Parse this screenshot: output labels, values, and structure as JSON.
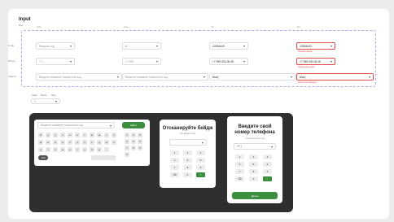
{
  "header": {
    "title": "Input",
    "subtitle": "Все"
  },
  "columns": [
    "Size",
    "Icon",
    "Tel",
    "Err"
  ],
  "rows": [
    {
      "label": "Code"
    },
    {
      "label": "Phone"
    },
    {
      "label": "Search"
    }
  ],
  "code_row": {
    "placeholder": "Введите код",
    "value": "1",
    "filled": "12334443",
    "error_value": "12334443",
    "error_text": "Ошибка ввода"
  },
  "phone_row": {
    "code_a": "+7 |",
    "code_b": "+7 999",
    "filled": "+7 999 000-00-00",
    "error_value": "+7 999 000-00-00",
    "error_text": "Неверный номер"
  },
  "search_row": {
    "placeholder_a": "Введите название товара или код",
    "placeholder_b": "Введите название товара или код",
    "value_a": "Мол|",
    "value_b": "Мол|",
    "error_text": "Ничего не найдено"
  },
  "mini_controls": {
    "labels": [
      "State",
      "Mode",
      "Size"
    ],
    "select_value": "S"
  },
  "keyboard_panel": {
    "search_placeholder": "Введите название товара или код",
    "action_label": "Найти",
    "letters_row1": [
      "й",
      "ц",
      "у",
      "к",
      "е",
      "н",
      "г",
      "ш",
      "щ",
      "з",
      "х"
    ],
    "letters_row2": [
      "ф",
      "ы",
      "в",
      "а",
      "п",
      "р",
      "о",
      "л",
      "д",
      "ж",
      "э"
    ],
    "letters_row3": [
      "я",
      "ч",
      "с",
      "м",
      "и",
      "т",
      "ь",
      "б",
      "ю",
      "."
    ],
    "bottom_label": "123",
    "numpad": [
      "1",
      "2",
      "3",
      "4",
      "5",
      "6",
      "7",
      "8",
      "9",
      "0"
    ]
  },
  "scan_modal": {
    "title": "Отсканируйте бейдж",
    "subtitle": "или введите код",
    "keys": [
      "1",
      "2",
      "3",
      "4",
      "5",
      "6",
      "7",
      "8",
      "9",
      "⌫",
      "0",
      "✓"
    ]
  },
  "phone_modal": {
    "title_line1": "Введите свой",
    "title_line2": "номер телефона",
    "subtitle": "Чтобы получить чек",
    "prefix": "+7 |",
    "keys": [
      "1",
      "2",
      "3",
      "4",
      "5",
      "6",
      "7",
      "8",
      "9",
      "⌫",
      "0",
      "✓"
    ],
    "submit_label": "Далее"
  },
  "colors": {
    "accent": "#3c8f3f",
    "error": "#e14b4b",
    "panel_border": "#b9a7ee",
    "dark_bg": "#2f2f2f"
  }
}
